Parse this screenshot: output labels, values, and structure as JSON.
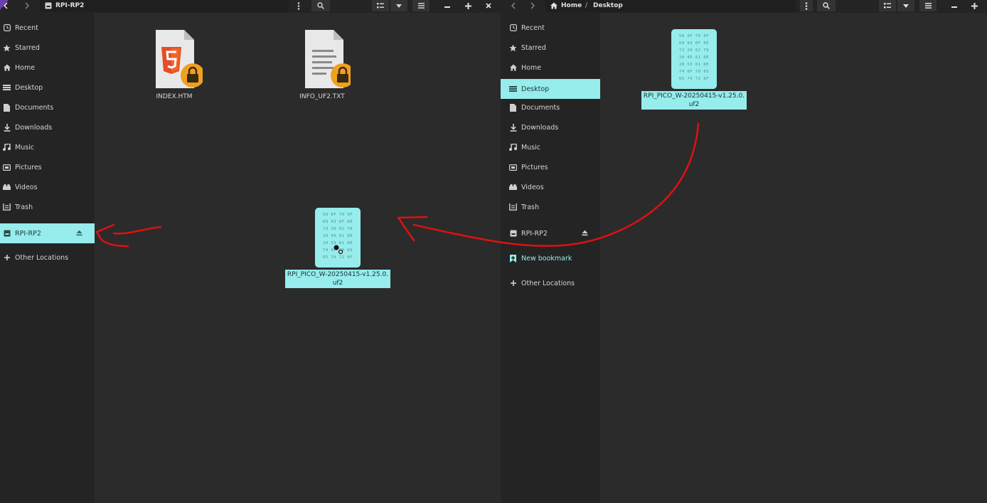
{
  "left_window": {
    "location_label": "RPI-RP2",
    "sidebar": [
      {
        "label": "Recent",
        "icon": "clock-icon"
      },
      {
        "label": "Starred",
        "icon": "star-icon"
      },
      {
        "label": "Home",
        "icon": "home-icon"
      },
      {
        "label": "Desktop",
        "icon": "desktop-icon"
      },
      {
        "label": "Documents",
        "icon": "document-icon"
      },
      {
        "label": "Downloads",
        "icon": "download-icon"
      },
      {
        "label": "Music",
        "icon": "music-icon"
      },
      {
        "label": "Pictures",
        "icon": "picture-icon"
      },
      {
        "label": "Videos",
        "icon": "video-icon"
      },
      {
        "label": "Trash",
        "icon": "trash-icon"
      },
      {
        "label": "RPI-RP2",
        "icon": "drive-icon",
        "selected": true,
        "eject": true
      },
      {
        "label": "Other Locations",
        "icon": "plus-icon"
      }
    ],
    "files": [
      {
        "name": "INDEX.HTM",
        "icon": "html5-file-icon",
        "locked": true
      },
      {
        "name": "INFO_UF2.TXT",
        "icon": "text-file-icon",
        "locked": true
      }
    ],
    "dragged_file": {
      "name_line1": "RPI_PICO_W-20250415-v1.25.0.",
      "name_line2": "uf2"
    }
  },
  "right_window": {
    "breadcrumb": {
      "home": "Home",
      "separator": "/",
      "current": "Desktop"
    },
    "sidebar": [
      {
        "label": "Recent",
        "icon": "clock-icon"
      },
      {
        "label": "Starred",
        "icon": "star-icon"
      },
      {
        "label": "Home",
        "icon": "home-icon"
      },
      {
        "label": "Desktop",
        "icon": "desktop-icon",
        "selected": true
      },
      {
        "label": "Documents",
        "icon": "document-icon"
      },
      {
        "label": "Downloads",
        "icon": "download-icon"
      },
      {
        "label": "Music",
        "icon": "music-icon"
      },
      {
        "label": "Pictures",
        "icon": "picture-icon"
      },
      {
        "label": "Videos",
        "icon": "video-icon"
      },
      {
        "label": "Trash",
        "icon": "trash-icon"
      },
      {
        "label": "RPI-RP2",
        "icon": "drive-icon",
        "eject": true
      },
      {
        "label": "New bookmark",
        "icon": "bookmark-icon"
      },
      {
        "label": "Other Locations",
        "icon": "plus-icon"
      }
    ],
    "file": {
      "name_line1": "RPI_PICO_W-20250415-v1.25.0.",
      "name_line2": "uf2"
    }
  },
  "hex_preview": [
    "50 6F 70 5F",
    "69 63 6F 6E",
    "73 20 62 79",
    "20 45 61 6E",
    "20 53 61 6E",
    "74 6F 70 65",
    "65 74 72 6F"
  ],
  "colors": {
    "accent": "#97ecec",
    "annotation": "#e01010",
    "lock": "#f0a020",
    "html5": "#e44d26"
  }
}
